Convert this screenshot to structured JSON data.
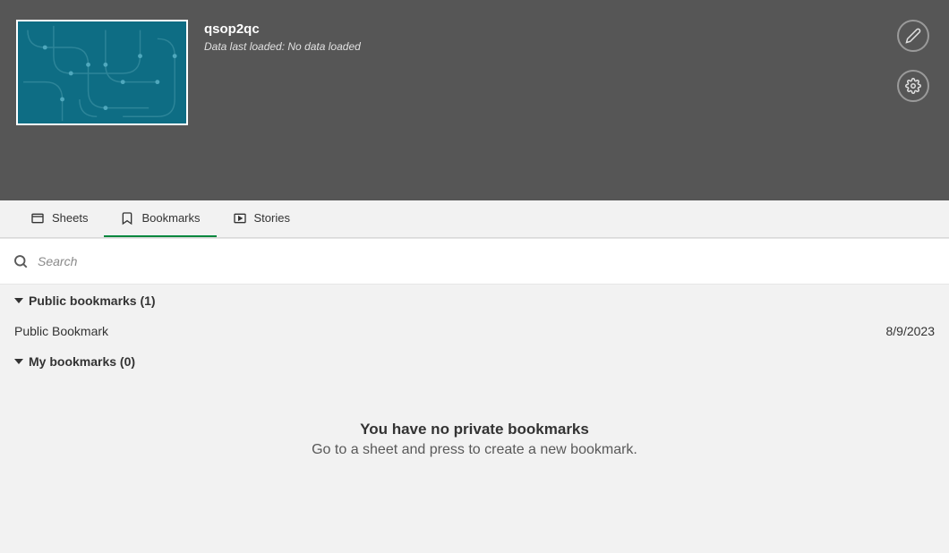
{
  "header": {
    "title": "qsop2qc",
    "data_status": "Data last loaded: No data loaded"
  },
  "tabs": {
    "sheets": "Sheets",
    "bookmarks": "Bookmarks",
    "stories": "Stories"
  },
  "search": {
    "placeholder": "Search"
  },
  "sections": {
    "public": {
      "title": "Public bookmarks (1)",
      "items": [
        {
          "name": "Public Bookmark",
          "date": "8/9/2023"
        }
      ]
    },
    "my": {
      "title": "My bookmarks (0)"
    }
  },
  "empty": {
    "title": "You have no private bookmarks",
    "subtitle": "Go to a sheet and press to create a new bookmark."
  }
}
